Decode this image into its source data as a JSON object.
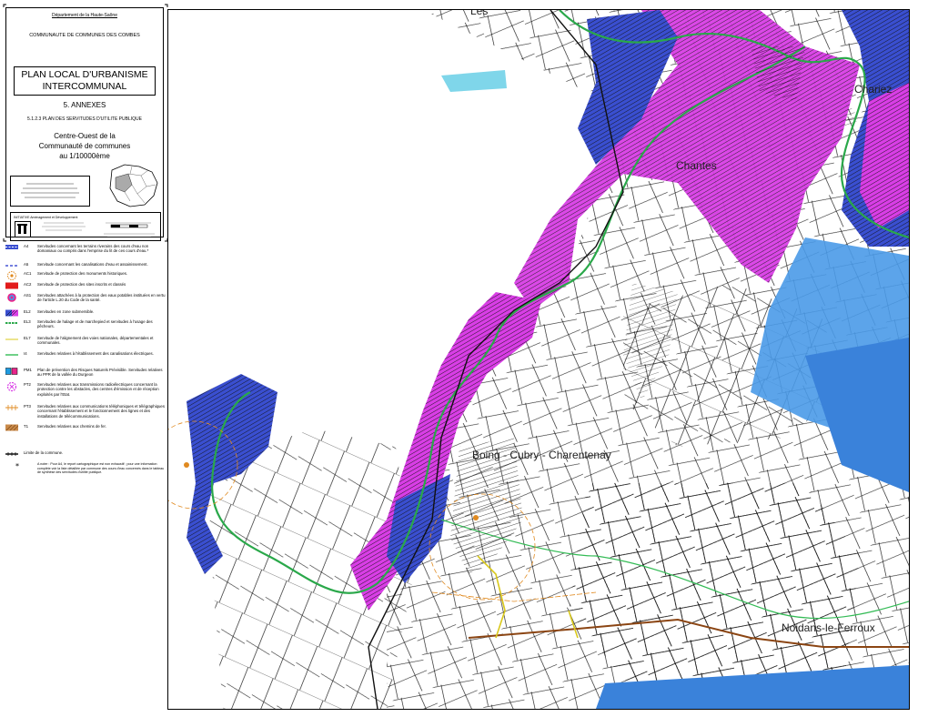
{
  "cartouche": {
    "department": "Département de la Haute-Saône",
    "community": "COMMUNAUTE DE COMMUNES DES COMBES",
    "plan_title_line1": "PLAN LOCAL D'URBANISME",
    "plan_title_line2": "INTERCOMMUNAL",
    "annex": "5. ANNEXES",
    "subtitle": "5.1.2.3 PLAN DES SERVITUDES D'UTILITE PUBLIQUE",
    "sector_line1": "Centre-Ouest de la",
    "sector_line2": "Communauté de communes",
    "scale": "au 1/10000ème",
    "credit_org": "INITIATIVE Aménagement et Développement"
  },
  "legend": [
    {
      "code": "A4",
      "text": "Servitudes concernant les terrains riverains des cours d'eau non domaniaux ou compris dans l'emprise du lit de ces cours d'eau.*",
      "color": "#3a4fd0",
      "icon": "dashed-band"
    },
    {
      "code": "A5",
      "text": "Servitude concernant les canalisations d'eau et assainissement.",
      "color": "#2233cc",
      "icon": "dashed-line"
    },
    {
      "code": "AC1",
      "text": "Servitude de protection des monuments historiques.",
      "color": "#e08a20",
      "icon": "monument-symbol"
    },
    {
      "code": "AC2",
      "text": "Servitude de protection des sites inscrits et classés",
      "color": "#e21b1b",
      "icon": "red-fill"
    },
    {
      "code": "AS1",
      "text": "Servitudes attachées à la protection des eaux potables instituées en vertu de l'article L.20 du Code de la santé.",
      "color": "#e8248a",
      "icon": "target-symbol"
    },
    {
      "code": "EL2",
      "text": "Servitudes en zone submersible.",
      "color": "#d93ee6",
      "icon": "hatch-fill"
    },
    {
      "code": "EL3",
      "text": "Servitudes de halage et de marchepied et servitudes à l'usage des pêcheurs.",
      "color": "#2aa84a",
      "icon": "green-dash"
    },
    {
      "code": "EL7",
      "text": "Servitude de l'alignement des voies nationales, départementales et communales.",
      "color": "#d9c81b",
      "icon": "yellow-line"
    },
    {
      "code": "I4",
      "text": "Servitudes relatives à l'établissement des canalisations électriques.",
      "color": "#33bb55",
      "icon": "green-line"
    },
    {
      "code": "PM1",
      "text": "Plan de prévention des Risques Naturels Prévisible. Servitudes relatives au PPR de la vallée du Durgeon",
      "color": "#1f9be0",
      "icon": "ppr-boxes"
    },
    {
      "code": "PT2",
      "text": "Servitudes relatives aux transmissions radioélectriques concernant la protection contre les obstacles, des centres d'émission et de réception exploités par l'Etat.",
      "color": "#d93ee6",
      "icon": "radio-symbol"
    },
    {
      "code": "PT3",
      "text": "Servitudes relatives aux communications téléphoniques et télégraphiques concernant l'établissement et le fonctionnement des lignes et des installations de télécommunications.",
      "color": "#e08a20",
      "icon": "phone-line"
    },
    {
      "code": "T1",
      "text": "Servitudes relatives aux chemins de fer.",
      "color": "#b0702a",
      "icon": "rail-fill"
    },
    {
      "code": "",
      "text": "Limite de la commune.",
      "color": "#000000",
      "icon": "boundary-line"
    },
    {
      "code": "",
      "text": "A noter : Pour A4, le report cartographique est non exhaustif ; pour une information complète voir la liste détaillée par commune des cours d'eau concernés dans le tableau de synthèse des servitudes d'utilité publique.",
      "color": "#000000",
      "icon": "star-note"
    }
  ],
  "map": {
    "places": [
      "Chariez",
      "Chantes",
      "Noidans-le-Ferroux",
      "Boing - Cubry - Charentenay",
      "Les"
    ],
    "colors": {
      "flood": "#d93ee6",
      "flood_blue": "#3a4fd0",
      "ppr": "#4a9ae8",
      "river": "#2aa84a",
      "rail": "#8b4513",
      "boundary": "#111111"
    }
  }
}
